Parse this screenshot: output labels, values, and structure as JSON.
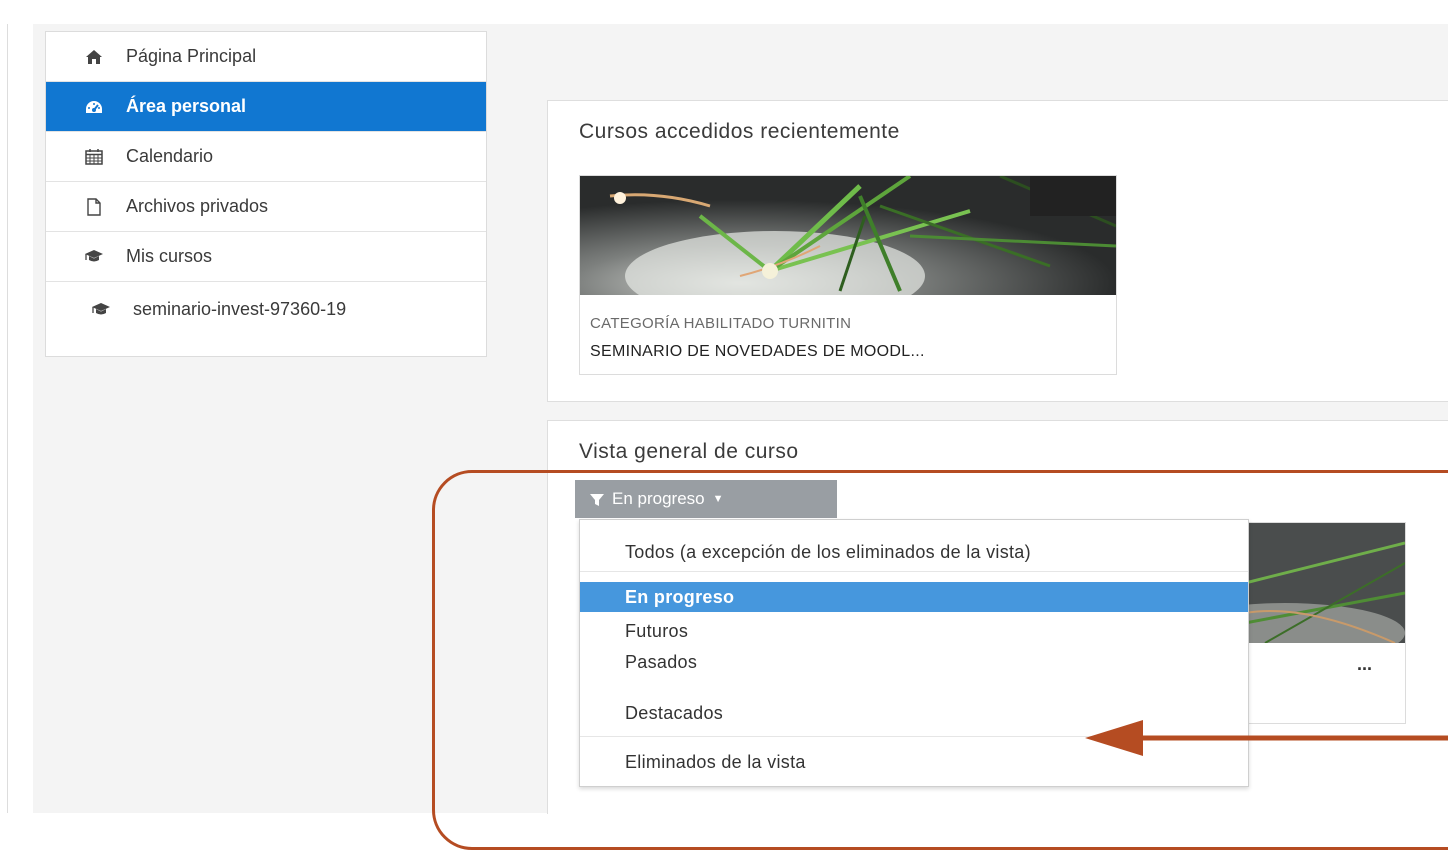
{
  "sidebar": {
    "items": [
      {
        "label": "Página Principal",
        "icon": "home-icon"
      },
      {
        "label": "Área personal",
        "icon": "dashboard-icon",
        "active": true
      },
      {
        "label": "Calendario",
        "icon": "calendar-icon"
      },
      {
        "label": "Archivos privados",
        "icon": "file-icon"
      },
      {
        "label": "Mis cursos",
        "icon": "graduation-cap-icon"
      },
      {
        "label": "seminario-invest-97360-19",
        "icon": "graduation-cap-icon"
      }
    ]
  },
  "recent": {
    "title": "Cursos accedidos recientemente",
    "card": {
      "category": "CATEGORÍA HABILITADO TURNITIN",
      "name": "SEMINARIO DE NOVEDADES DE MOODL..."
    }
  },
  "overview": {
    "title": "Vista general de curso",
    "filter_label": "En progreso",
    "card_menu": "...",
    "menu": [
      {
        "label": "Todos (a excepción de los eliminados de la vista)"
      },
      {
        "label": "En progreso",
        "selected": true
      },
      {
        "label": "Futuros"
      },
      {
        "label": "Pasados"
      },
      {
        "label": "Destacados"
      },
      {
        "label": "Eliminados de la vista"
      }
    ]
  },
  "colors": {
    "active_sidebar": "#1177d1",
    "menu_selected": "#4697dd",
    "annotation": "#b54c22",
    "filter_button": "#999ea3"
  }
}
